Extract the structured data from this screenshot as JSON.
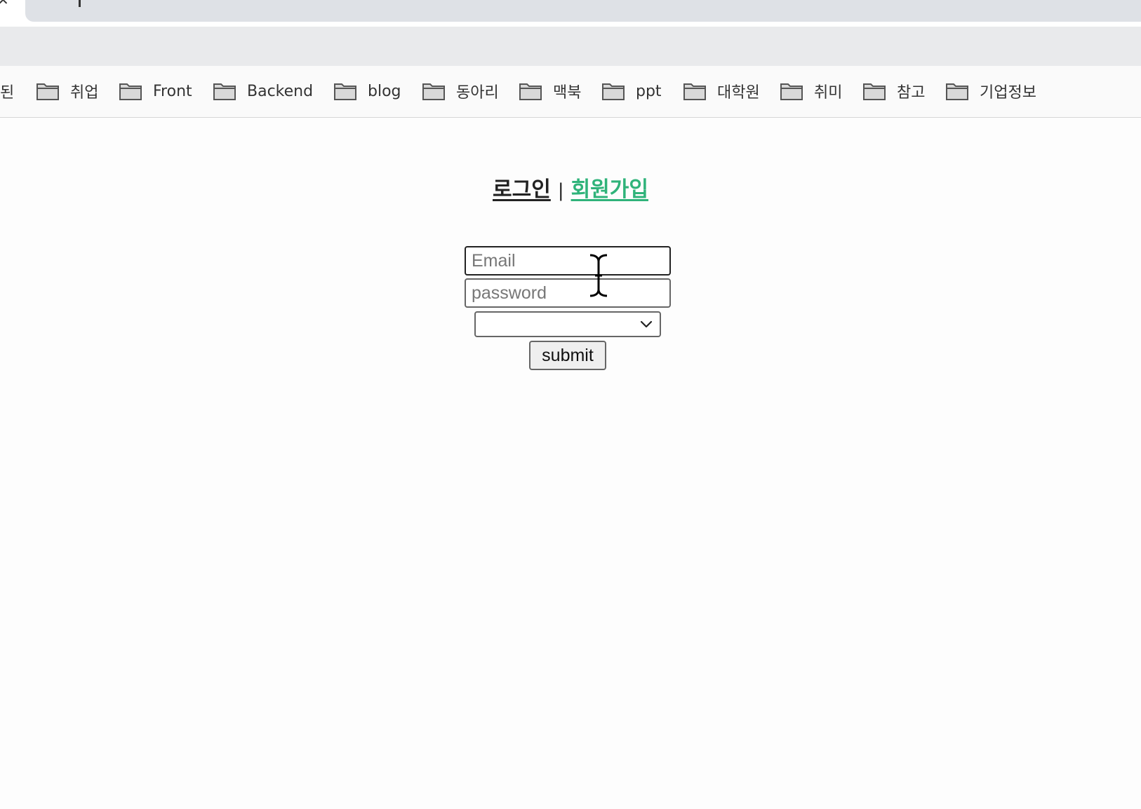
{
  "browser": {
    "close_glyph": "✕",
    "bookmarks_partial_label": "된",
    "bookmarks": [
      {
        "label": "취업",
        "icon": "folder-icon"
      },
      {
        "label": "Front",
        "icon": "folder-icon"
      },
      {
        "label": "Backend",
        "icon": "folder-icon"
      },
      {
        "label": "blog",
        "icon": "folder-icon"
      },
      {
        "label": "동아리",
        "icon": "folder-icon"
      },
      {
        "label": "맥북",
        "icon": "folder-icon"
      },
      {
        "label": "ppt",
        "icon": "folder-icon"
      },
      {
        "label": "대학원",
        "icon": "folder-icon"
      },
      {
        "label": "취미",
        "icon": "folder-icon"
      },
      {
        "label": "참고",
        "icon": "folder-icon"
      },
      {
        "label": "기업정보",
        "icon": "folder-icon"
      }
    ]
  },
  "auth_nav": {
    "login_label": "로그인",
    "separator": "|",
    "signup_label": "회원가입",
    "login_color": "#222222",
    "signup_color": "#2fb37a"
  },
  "form": {
    "email": {
      "value": "",
      "placeholder": "Email"
    },
    "password": {
      "value": "",
      "placeholder": "password"
    },
    "select": {
      "selected": ""
    },
    "submit_label": "submit"
  },
  "cursor": {
    "icon": "text-cursor-icon"
  }
}
